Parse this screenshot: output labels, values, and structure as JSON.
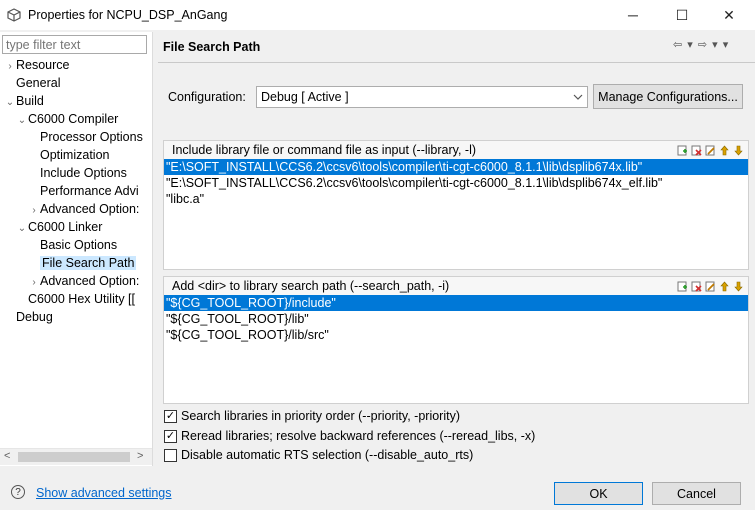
{
  "window": {
    "title": "Properties for NCPU_DSP_AnGang",
    "min_icon": "─",
    "max_icon": "☐",
    "close_icon": "✕"
  },
  "left_panel": {
    "filter_placeholder": "type filter text",
    "tree": [
      {
        "label": "Resource",
        "toggle": "›",
        "indent": 0
      },
      {
        "label": "General",
        "toggle": "",
        "indent": 0
      },
      {
        "label": "Build",
        "toggle": "⌄",
        "indent": 0
      },
      {
        "label": "C6000 Compiler",
        "toggle": "⌄",
        "indent": 1
      },
      {
        "label": "Processor Options",
        "toggle": "",
        "indent": 2
      },
      {
        "label": "Optimization",
        "toggle": "",
        "indent": 2
      },
      {
        "label": "Include Options",
        "toggle": "",
        "indent": 2
      },
      {
        "label": "Performance Advi",
        "toggle": "",
        "indent": 2
      },
      {
        "label": "Advanced Option:",
        "toggle": "›",
        "indent": 2
      },
      {
        "label": "C6000 Linker",
        "toggle": "⌄",
        "indent": 1
      },
      {
        "label": "Basic Options",
        "toggle": "",
        "indent": 2
      },
      {
        "label": "File Search Path",
        "toggle": "",
        "indent": 2,
        "selected": true
      },
      {
        "label": "Advanced Option:",
        "toggle": "›",
        "indent": 2
      },
      {
        "label": "C6000 Hex Utility  [[",
        "toggle": "",
        "indent": 1
      },
      {
        "label": "Debug",
        "toggle": "",
        "indent": 0
      }
    ],
    "scroll_left": "<",
    "scroll_right": ">"
  },
  "main": {
    "title": "File Search Path",
    "nav": "⇦ ▾ ⇨ ▾ ▾",
    "configuration_label": "Configuration:",
    "configuration_value": "Debug  [ Active ]",
    "manage_button": "Manage Configurations...",
    "library_group": {
      "title": "Include library file or command file as input (--library, -l)",
      "items": [
        "\"E:\\SOFT_INSTALL\\CCS6.2\\ccsv6\\tools\\compiler\\ti-cgt-c6000_8.1.1\\lib\\dsplib674x.lib\"",
        "\"E:\\SOFT_INSTALL\\CCS6.2\\ccsv6\\tools\\compiler\\ti-cgt-c6000_8.1.1\\lib\\dsplib674x_elf.lib\"",
        "\"libc.a\""
      ],
      "selected_index": 0
    },
    "search_group": {
      "title": "Add <dir> to library search path (--search_path, -i)",
      "items": [
        "\"${CG_TOOL_ROOT}/include\"",
        "\"${CG_TOOL_ROOT}/lib\"",
        "\"${CG_TOOL_ROOT}/lib/src\""
      ],
      "selected_index": 0
    },
    "checkboxes": [
      {
        "label": "Search libraries in priority order (--priority, -priority)",
        "checked": true
      },
      {
        "label": "Reread libraries; resolve backward references (--reread_libs, -x)",
        "checked": true
      },
      {
        "label": "Disable automatic RTS selection (--disable_auto_rts)",
        "checked": false
      }
    ]
  },
  "footer": {
    "help_icon": "?",
    "advanced_link": "Show advanced settings",
    "ok_label": "OK",
    "cancel_label": "Cancel"
  },
  "colors": {
    "selection": "#0078d7",
    "tree_selection": "#cce8ff",
    "link": "#0066cc"
  },
  "icons": {
    "group_tools": [
      "add-icon",
      "delete-icon",
      "edit-icon",
      "move-up-icon",
      "move-down-icon"
    ]
  }
}
